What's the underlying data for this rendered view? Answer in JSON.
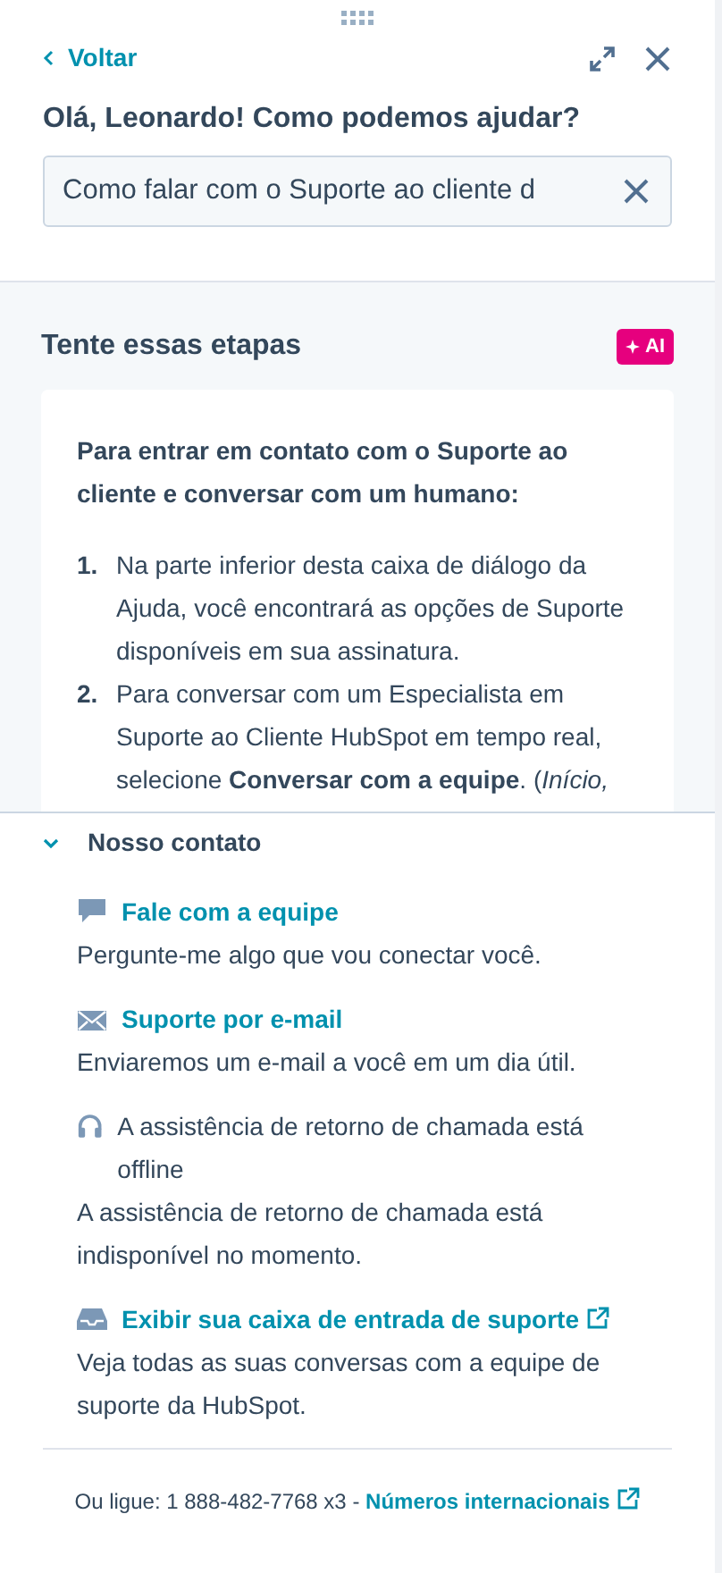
{
  "header": {
    "back": "Voltar",
    "greeting": "Olá, Leonardo! Como podemos ajudar?",
    "search": {
      "value": "Como falar com o Suporte ao cliente d"
    }
  },
  "steps": {
    "title": "Tente essas etapas",
    "badge": "AI",
    "intro": "Para entrar em contato com o Suporte ao cliente e conversar com um humano:",
    "items": [
      {
        "number": "1.",
        "text": "Na parte inferior desta caixa de diálogo da Ajuda, você encontrará as opções de Suporte disponíveis em sua assinatura."
      },
      {
        "number": "2.",
        "text": "Para conversar com um Especialista em Suporte ao Cliente HubSpot em tempo real, selecione **Conversar com a equipe**. (*Início,*"
      }
    ]
  },
  "contact": {
    "title": "Nosso contato",
    "expanded": true,
    "items": [
      {
        "kind": "link",
        "title": "Fale com a equipe",
        "text": "Pergunte-me algo que vou conectar você."
      },
      {
        "kind": "link",
        "title": "Suporte por e-mail",
        "text": "Enviaremos um e-mail a você em um dia útil."
      },
      {
        "kind": "status",
        "title": "A assistência de retorno de chamada está offline",
        "text": "A assistência de retorno de chamada está indisponível no momento."
      },
      {
        "kind": "external-link",
        "title": "Exibir sua caixa de entrada de suporte",
        "text": "Veja todas as suas conversas com a equipe de suporte da HubSpot."
      }
    ]
  },
  "footer": {
    "phone": "Ou ligue: 1 888-482-7768 x3 -",
    "link": "Números internacionais"
  }
}
